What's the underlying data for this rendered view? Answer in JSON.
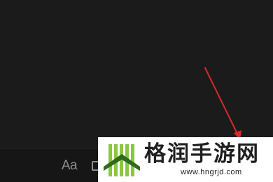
{
  "toolbar": {
    "font_label": "Aa",
    "font_icon": "text-format-icon",
    "image_icon": "image-icon"
  },
  "annotation": {
    "arrow_color": "#d42a2a",
    "arrow_icon": "arrow-down-right-icon"
  },
  "watermark": {
    "title": "格润手游网",
    "url": "www.hngrjd.com",
    "logo_icon": "green-stripes-logo-icon",
    "logo_colors": [
      "#6db33f",
      "#2e6b1f"
    ]
  },
  "colors": {
    "background": "#1b1b1c",
    "toolbar_background": "#161617",
    "icon_gray": "#8e8e90"
  }
}
